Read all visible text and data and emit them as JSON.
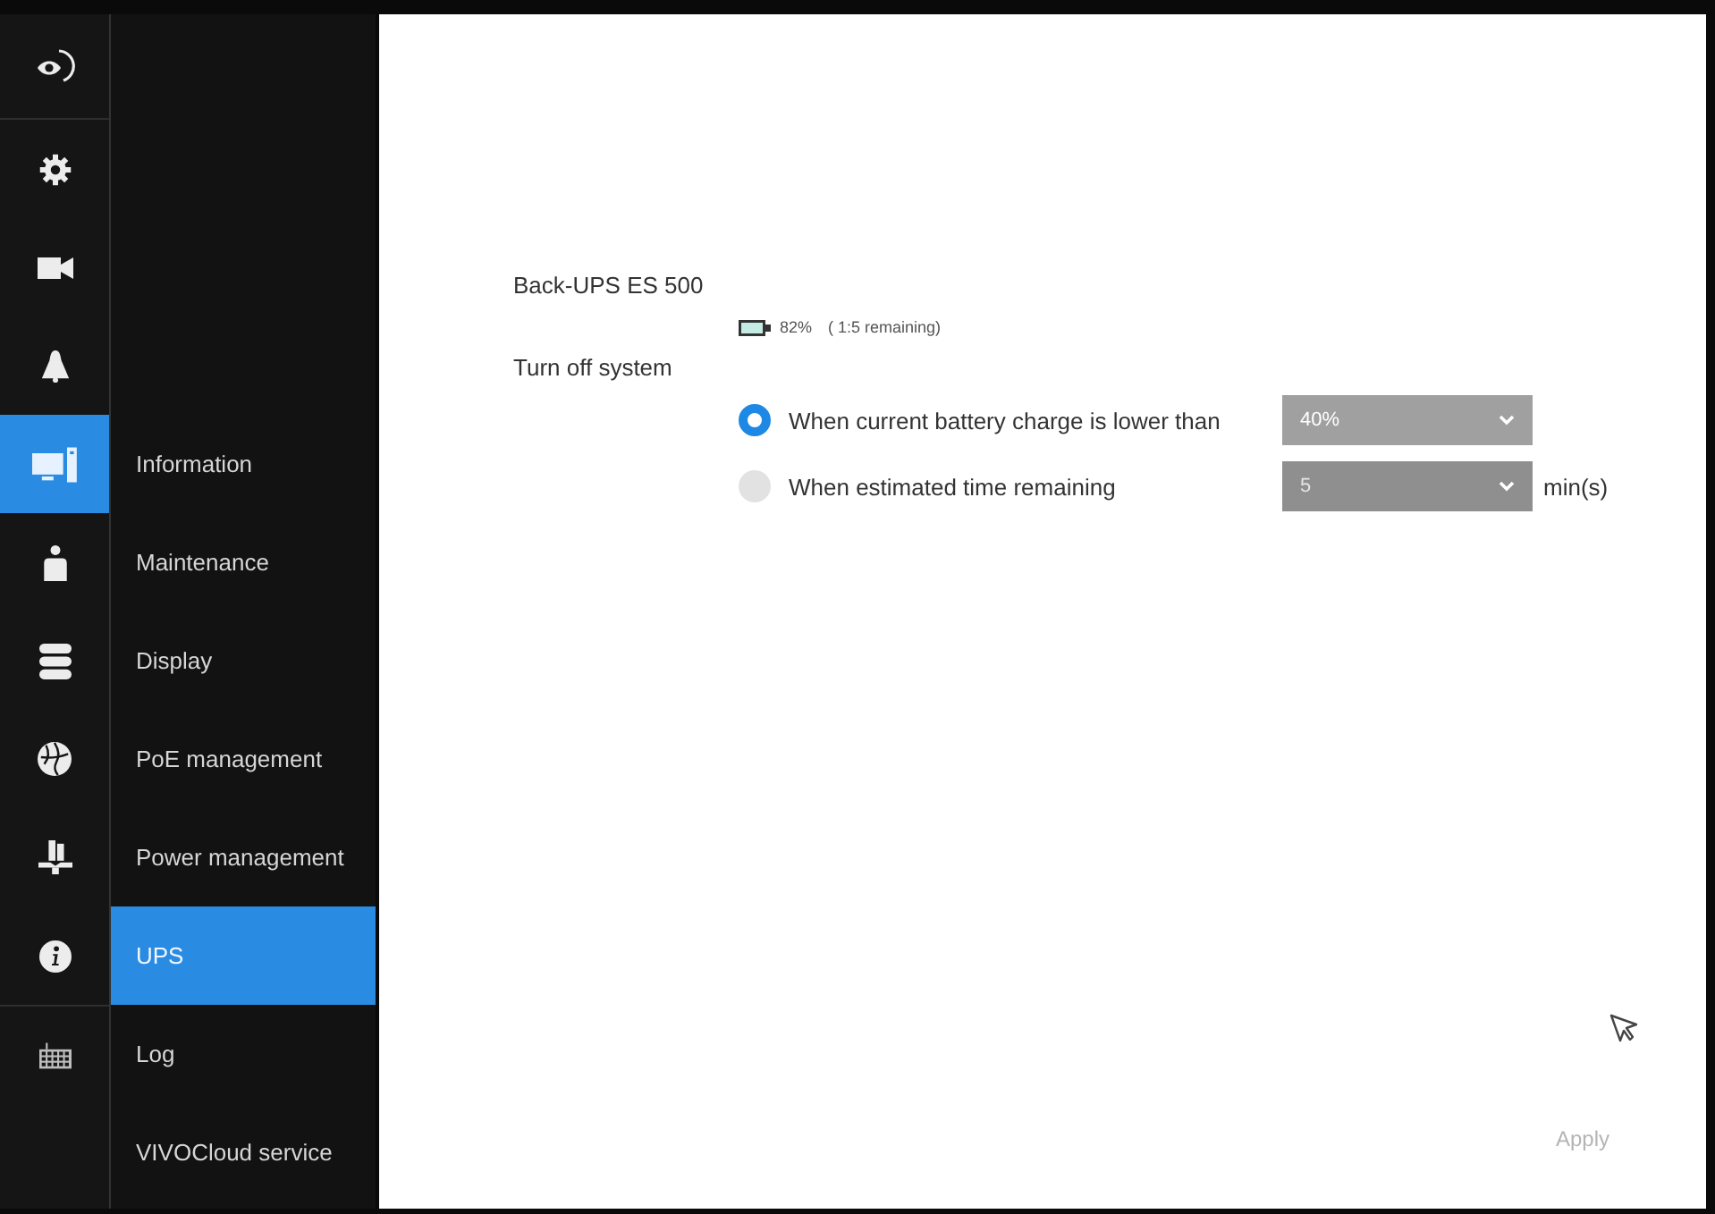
{
  "icon_bar": {
    "items": [
      {
        "selected": false
      },
      {
        "selected": false
      },
      {
        "selected": false
      },
      {
        "selected": false
      },
      {
        "selected": true
      },
      {
        "selected": false
      },
      {
        "selected": false
      },
      {
        "selected": false
      },
      {
        "selected": false
      },
      {
        "selected": false
      },
      {
        "selected": false
      }
    ]
  },
  "submenu": {
    "items": [
      {
        "label": "Information",
        "selected": false
      },
      {
        "label": "Maintenance",
        "selected": false
      },
      {
        "label": "Display",
        "selected": false
      },
      {
        "label": "PoE management",
        "selected": false
      },
      {
        "label": "Power management",
        "selected": false
      },
      {
        "label": "UPS",
        "selected": true
      },
      {
        "label": "Log",
        "selected": false
      },
      {
        "label": "VIVOCloud service",
        "selected": false
      }
    ]
  },
  "ups": {
    "model": "Back-UPS ES 500",
    "battery": {
      "charge": "82%",
      "remaining": "( 1:5 remaining)"
    }
  },
  "turn_off": {
    "label": "Turn off system",
    "options": [
      {
        "label": "When current battery charge is lower than",
        "selected": true,
        "dropdown": {
          "value": "40%",
          "disabled": false
        }
      },
      {
        "label": "When estimated time remaining",
        "selected": false,
        "dropdown": {
          "value": "5",
          "disabled": true
        },
        "unit": "min(s)"
      }
    ]
  },
  "apply_button": {
    "label": "Apply",
    "disabled": true
  }
}
